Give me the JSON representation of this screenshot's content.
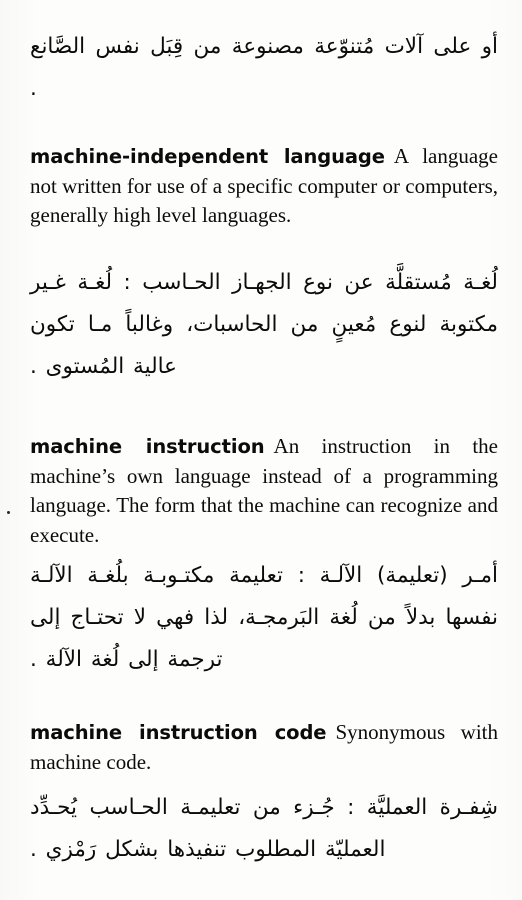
{
  "page": {
    "kind": "scanned-dictionary-page",
    "languages": [
      "English",
      "Arabic"
    ],
    "ink_color": "#0b0b0b",
    "paper_color": "#fdfdfc"
  },
  "arabic_continuation": {
    "text": "أو على آلات مُتنوّعة مصنوعة من قِبَل نفس الصَّانع ."
  },
  "entries": [
    {
      "headword": "machine-independent language",
      "definition": "A language not written for use of a specific computer or computers, generally high level languages.",
      "arabic": "لُغـة مُستقلَّة عن نوع الجهـاز الحـاسب : لُغـة غـير مكتوبة لنوع مُعينٍ من الحاسبات، وغالباً مـا تكون عالية المُستوى ."
    },
    {
      "headword": "machine instruction",
      "definition": "An instruction in the machine’s own language instead of a programming language. The form that the machine can recognize and execute.",
      "arabic": "أمـر (تعليمة) الآلـة : تعليمة مكتـوبـة بلُغـة الآلـة نفسها بدلاً من لُغة البَرمجـة، لذا فهي لا تحتـاج إلى ترجمة إلى لُغة الآلة ."
    },
    {
      "headword": "machine instruction code",
      "definition": "Synonymous with machine code.",
      "arabic": "شِفـرة العمليَّة : جُـزء من تعليمـة الحـاسب يُحـدِّد العمليّة المطلوب تنفيذها بشكل رَمْزي ."
    }
  ]
}
